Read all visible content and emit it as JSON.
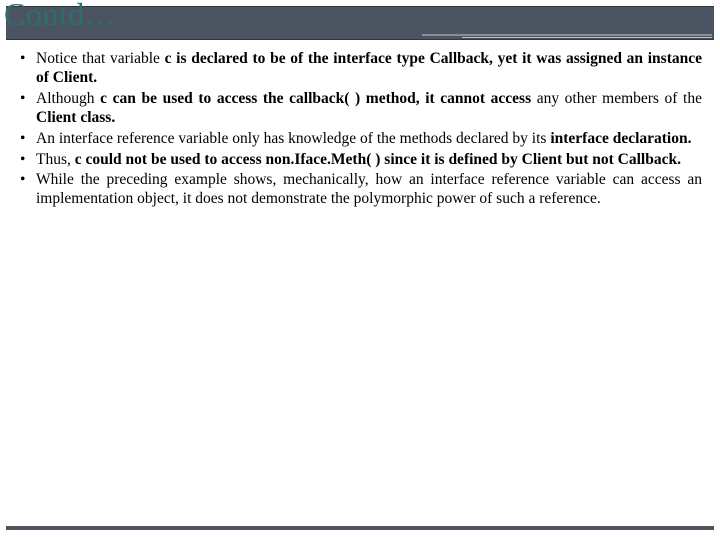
{
  "title": "Contd…",
  "bullets": [
    {
      "pre": "Notice that variable ",
      "bold": "c is declared to be of the interface type Callback, yet it was assigned an instance of Client.",
      "post": ""
    },
    {
      "pre": "Although ",
      "bold": "c can be used to access the callback( ) method, it cannot access",
      "post": " any other members of the ",
      "bold2": "Client class.",
      "post2": ""
    },
    {
      "pre": "An interface reference variable only has knowledge of the methods declared by its ",
      "bold": "interface declaration.",
      "post": ""
    },
    {
      "pre": "Thus, ",
      "bold": "c could not be used to access non.Iface.Meth( ) since it is defined by Client but not Callback.",
      "post": ""
    },
    {
      "pre": "While the preceding example shows, mechanically, how an interface reference variable can access an implementation object, it does not demonstrate the polymorphic power of such a reference.",
      "bold": "",
      "post": ""
    }
  ]
}
